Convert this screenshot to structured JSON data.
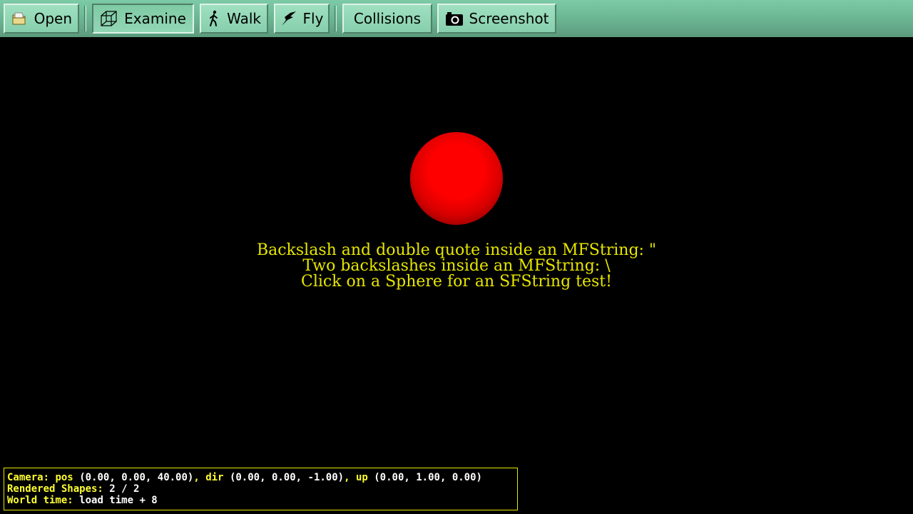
{
  "toolbar": {
    "open_label": "Open",
    "examine_label": "Examine",
    "walk_label": "Walk",
    "fly_label": "Fly",
    "collisions_label": "Collisions",
    "screenshot_label": "Screenshot",
    "icons": {
      "open": "folder-icon",
      "examine": "cube-icon",
      "walk": "walking-person-icon",
      "fly": "bird-icon",
      "screenshot": "camera-icon"
    }
  },
  "scene": {
    "lines": [
      "Backslash and double quote inside an MFString: \"",
      "Two backslashes inside an MFString: \\",
      "Click on a Sphere for an SFString test!"
    ],
    "text_color": "#e6e600",
    "sphere_color": "#ff0000"
  },
  "status": {
    "camera_label": "Camera:",
    "pos_label": "pos",
    "pos_value": "(0.00, 0.00, 40.00)",
    "dir_label": "dir",
    "dir_value": "(0.00, 0.00, -1.00)",
    "up_label": "up",
    "up_value": "(0.00, 1.00, 0.00)",
    "shapes_label": "Rendered Shapes:",
    "shapes_value": "2 / 2",
    "time_label": "World time:",
    "time_value": "load time + 8"
  }
}
